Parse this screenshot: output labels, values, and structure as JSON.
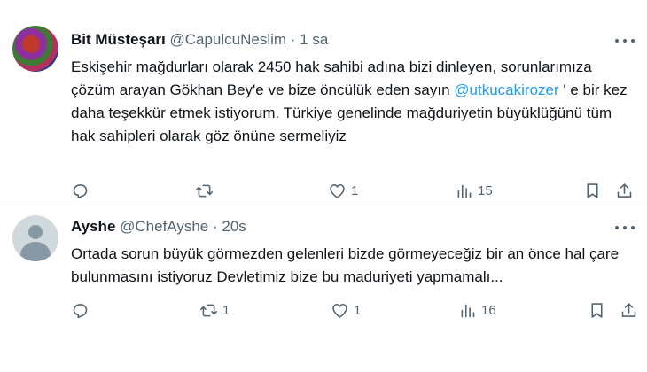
{
  "tweets": [
    {
      "display_name": "Bit Müsteşarı",
      "handle": "@CapulcuNeslim",
      "dot": "·",
      "time": "1 sa",
      "text_before": "Eskişehir mağdurları olarak 2450 hak sahibi adına bizi dinleyen, sorunlarımıza çözüm arayan Gökhan Bey'e ve bize öncülük eden sayın ",
      "mention": "@utkucakirozer",
      "text_after": " ' e bir kez daha teşekkür etmek istiyorum. Türkiye genelinde mağduriyetin büyüklüğünü tüm hak sahipleri olarak göz önüne sermeliyiz",
      "replies": "",
      "retweets": "",
      "likes": "1",
      "views": "15"
    },
    {
      "display_name": "Ayshe",
      "handle": "@ChefAyshe",
      "dot": "·",
      "time": "20s",
      "text": "Ortada sorun büyük görmezden gelenleri bizde görmeyeceğiz bir an önce hal çare bulunmasını istiyoruz Devletimiz bize bu maduriyeti yapmamalı...",
      "replies": "",
      "retweets": "1",
      "likes": "1",
      "views": "16"
    }
  ],
  "icons": {
    "reply": "reply-icon",
    "retweet": "retweet-icon",
    "like": "heart-icon",
    "views": "views-icon",
    "bookmark": "bookmark-icon",
    "share": "share-icon",
    "more": "more-icon"
  },
  "colors": {
    "text": "#0f1419",
    "secondary": "#536471",
    "mention": "#1d9bf0",
    "divider": "#eff3f4"
  }
}
